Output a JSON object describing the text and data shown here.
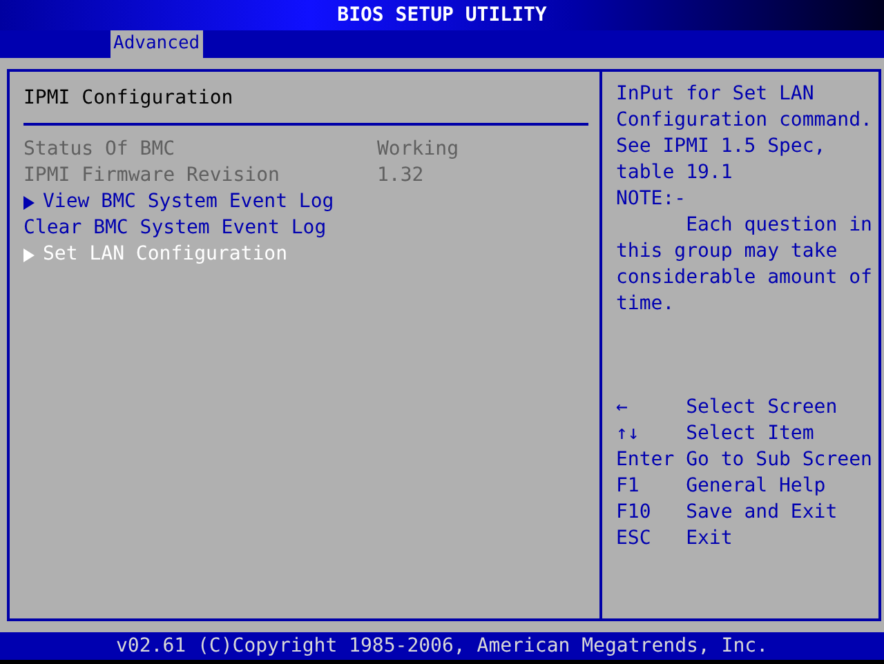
{
  "window": {
    "title": "BIOS SETUP UTILITY"
  },
  "tabs": [
    {
      "label": "Advanced",
      "selected": true
    }
  ],
  "section": {
    "title": "IPMI Configuration"
  },
  "items": [
    {
      "kind": "info",
      "label": "Status Of BMC",
      "value": "Working",
      "selected": false
    },
    {
      "kind": "info",
      "label": "IPMI Firmware Revision",
      "value": "1.32",
      "selected": false
    },
    {
      "kind": "submenu",
      "label": "View BMC System Event Log",
      "selected": false
    },
    {
      "kind": "action",
      "label": "Clear BMC System Event Log",
      "selected": false
    },
    {
      "kind": "submenu",
      "label": "Set LAN Configuration",
      "selected": true
    }
  ],
  "help": {
    "paragraphs": [
      {
        "kind": "plain",
        "text": "InPut for Set LAN Configuration command. See IPMI 1.5 Spec, table 19.1"
      },
      {
        "kind": "plain",
        "text": "NOTE:-"
      },
      {
        "kind": "indented",
        "text": "Each question in this group may take considerable amount of time."
      }
    ],
    "keys": [
      {
        "key": "←",
        "action": "Select Screen"
      },
      {
        "key": "↑↓",
        "action": "Select Item"
      },
      {
        "key": "Enter",
        "action": "Go to Sub Screen"
      },
      {
        "key": "F1",
        "action": "General Help"
      },
      {
        "key": "F10",
        "action": "Save and Exit"
      },
      {
        "key": "ESC",
        "action": "Exit"
      }
    ]
  },
  "status_bar": "v02.61 (C)Copyright 1985-2006, American Megatrends, Inc."
}
